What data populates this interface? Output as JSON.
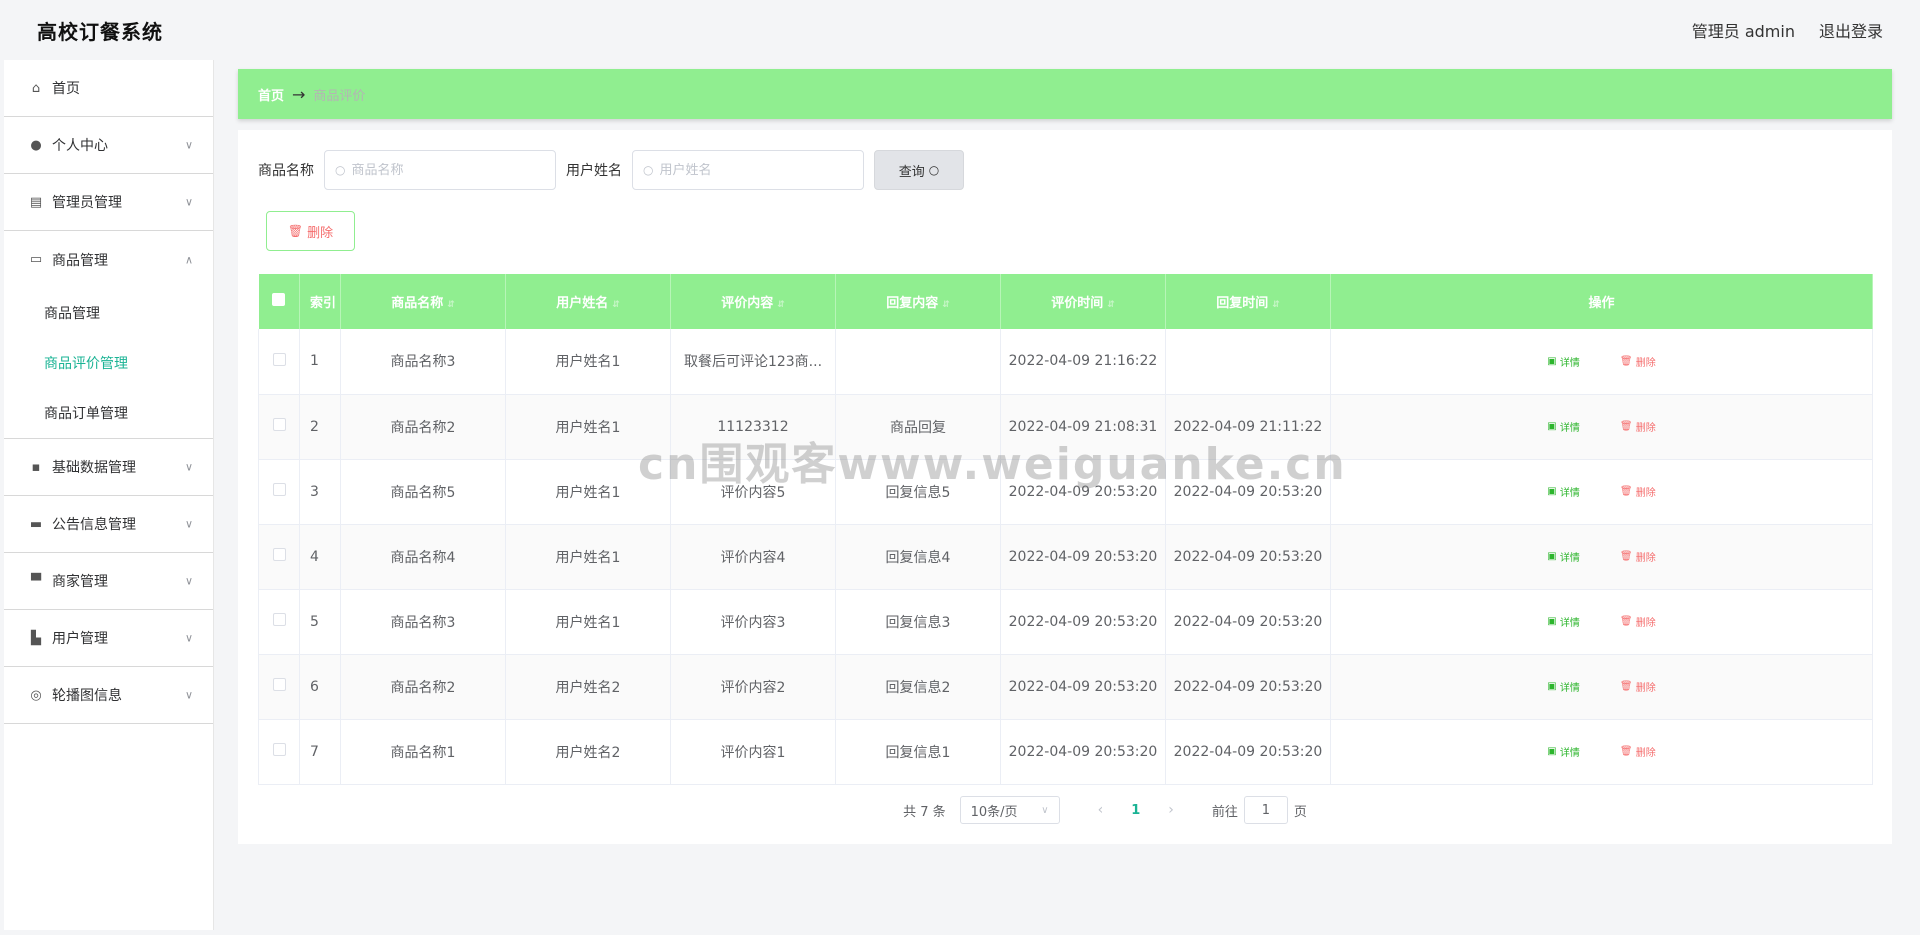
{
  "header": {
    "brand": "高校订餐系统",
    "user": "管理员 admin",
    "logout": "退出登录"
  },
  "sidebar": {
    "items": [
      {
        "label": "首页",
        "icon": "home-icon",
        "expandable": false
      },
      {
        "label": "个人中心",
        "icon": "user-icon",
        "expandable": true
      },
      {
        "label": "管理员管理",
        "icon": "clipboard-icon",
        "expandable": true
      },
      {
        "label": "商品管理",
        "icon": "card-icon",
        "expandable": true,
        "expanded": true,
        "children": [
          {
            "label": "商品管理",
            "active": false
          },
          {
            "label": "商品评价管理",
            "active": true
          },
          {
            "label": "商品订单管理",
            "active": false
          }
        ]
      },
      {
        "label": "基础数据管理",
        "icon": "chat-icon",
        "expandable": true
      },
      {
        "label": "公告信息管理",
        "icon": "notice-icon",
        "expandable": true
      },
      {
        "label": "商家管理",
        "icon": "shop-icon",
        "expandable": true
      },
      {
        "label": "用户管理",
        "icon": "users-icon",
        "expandable": true
      },
      {
        "label": "轮播图信息",
        "icon": "carousel-icon",
        "expandable": true
      }
    ]
  },
  "breadcrumb": {
    "home": "首页",
    "current": "商品评价"
  },
  "search": {
    "product_label": "商品名称",
    "product_placeholder": "商品名称",
    "user_label": "用户姓名",
    "user_placeholder": "用户姓名",
    "query_label": "查询"
  },
  "toolbar": {
    "delete_label": "删除"
  },
  "table": {
    "columns": [
      "索引",
      "商品名称",
      "用户姓名",
      "评价内容",
      "回复内容",
      "评价时间",
      "回复时间",
      "操作"
    ],
    "rows": [
      {
        "index": "1",
        "product": "商品名称3",
        "user": "用户姓名1",
        "content": "取餐后可评论123商...",
        "reply": "",
        "time": "2022-04-09 21:16:22",
        "reply_time": ""
      },
      {
        "index": "2",
        "product": "商品名称2",
        "user": "用户姓名1",
        "content": "11123312",
        "reply": "商品回复",
        "time": "2022-04-09 21:08:31",
        "reply_time": "2022-04-09 21:11:22"
      },
      {
        "index": "3",
        "product": "商品名称5",
        "user": "用户姓名1",
        "content": "评价内容5",
        "reply": "回复信息5",
        "time": "2022-04-09 20:53:20",
        "reply_time": "2022-04-09 20:53:20"
      },
      {
        "index": "4",
        "product": "商品名称4",
        "user": "用户姓名1",
        "content": "评价内容4",
        "reply": "回复信息4",
        "time": "2022-04-09 20:53:20",
        "reply_time": "2022-04-09 20:53:20"
      },
      {
        "index": "5",
        "product": "商品名称3",
        "user": "用户姓名1",
        "content": "评价内容3",
        "reply": "回复信息3",
        "time": "2022-04-09 20:53:20",
        "reply_time": "2022-04-09 20:53:20"
      },
      {
        "index": "6",
        "product": "商品名称2",
        "user": "用户姓名2",
        "content": "评价内容2",
        "reply": "回复信息2",
        "time": "2022-04-09 20:53:20",
        "reply_time": "2022-04-09 20:53:20"
      },
      {
        "index": "7",
        "product": "商品名称1",
        "user": "用户姓名2",
        "content": "评价内容1",
        "reply": "回复信息1",
        "time": "2022-04-09 20:53:20",
        "reply_time": "2022-04-09 20:53:20"
      }
    ],
    "actions": {
      "detail": "详情",
      "delete": "删除"
    }
  },
  "pagination": {
    "total": "共 7 条",
    "page_size": "10条/页",
    "current_page": "1",
    "goto_prefix": "前往",
    "goto_value": "1",
    "goto_suffix": "页"
  },
  "watermark": "cn围观客www.weiguanke.cn"
}
